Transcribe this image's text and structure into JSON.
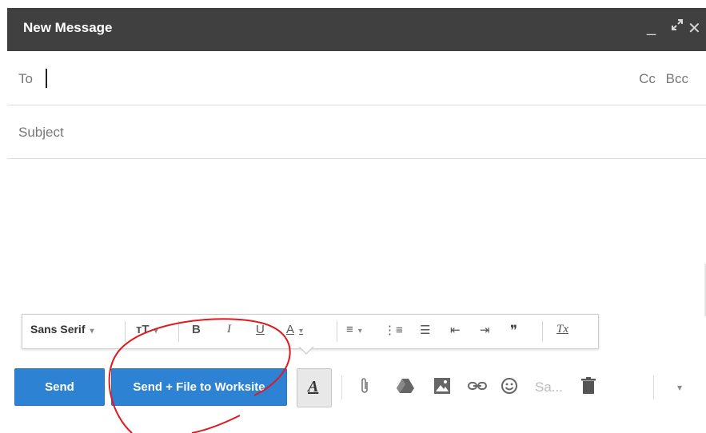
{
  "window": {
    "title": "New Message",
    "minimize": "_",
    "expand": "⤢",
    "close": "✕"
  },
  "to": {
    "label": "To",
    "cc": "Cc",
    "bcc": "Bcc"
  },
  "subject": {
    "placeholder": "Subject"
  },
  "format_toolbar": {
    "font": "Sans Serif",
    "font_arrow": "▾",
    "size_icon": "ᴛT",
    "bold": "B",
    "italic": "I",
    "underline": "U",
    "text_color": "A",
    "align": "≡",
    "numbered_list": "⋮≡",
    "bulleted_list": "☰",
    "indent_less": "⇤",
    "indent_more": "⇥",
    "quote": "❞",
    "remove_formatting": "Tx"
  },
  "actions": {
    "send": "Send",
    "send_file": "Send + File to Worksite",
    "formatting": "A",
    "signature": "Sa...",
    "more_arrow": "▾"
  },
  "icons": {
    "attach": "paperclip-icon",
    "drive": "drive-icon",
    "photo": "photo-icon",
    "link": "link-icon",
    "emoji": "emoji-icon",
    "trash": "trash-icon"
  },
  "colors": {
    "titlebar": "#404040",
    "primary": "#2d82d4",
    "annotation": "#e0191e"
  }
}
